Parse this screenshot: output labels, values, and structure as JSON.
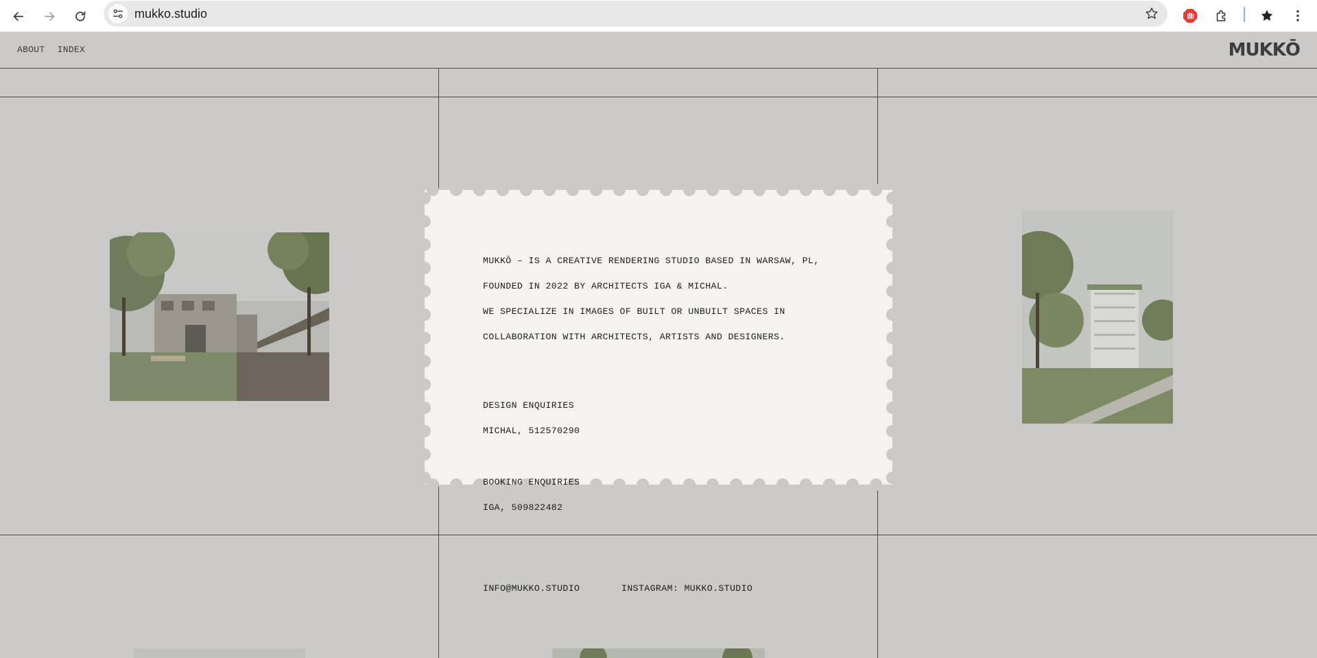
{
  "browser": {
    "url": "mukko.studio"
  },
  "nav": {
    "about": "ABOUT",
    "index": "INDEX"
  },
  "logo": "MUKKŌ",
  "card": {
    "intro": [
      "MUKKŌ – IS A CREATIVE RENDERING STUDIO BASED IN WARSAW, PL,",
      "FOUNDED IN 2022 BY ARCHITECTS IGA & MICHAL.",
      "WE SPECIALIZE IN IMAGES OF BUILT OR UNBUILT SPACES IN",
      "COLLABORATION WITH ARCHITECTS, ARTISTS AND DESIGNERS."
    ],
    "design_title": "DESIGN ENQUIRIES",
    "design_contact": "MICHAL, 512570290",
    "booking_title": "BOOKING ENQUIRIES",
    "booking_contact": "IGA, 509822482",
    "email": "INFO@MUKKO.STUDIO",
    "instagram": "INSTAGRAM: MUKKO.STUDIO"
  },
  "colors": {
    "page_bg": "#cbcac8",
    "card_bg": "#f4f3ef",
    "grid_line": "#4a4a4a"
  }
}
